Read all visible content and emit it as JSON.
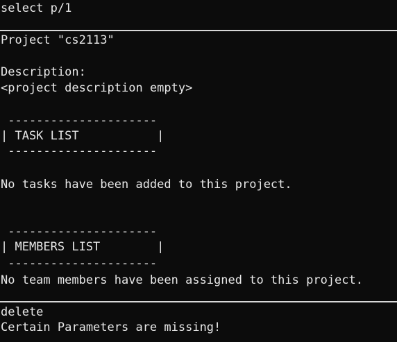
{
  "command_1": "select p/1",
  "output": {
    "project_title": "Project \"cs2113\"",
    "description_label": "Description:",
    "description_value": "<project description empty>",
    "task_box_top": " ---------------------",
    "task_box_label": "| TASK LIST           |",
    "task_box_bottom": " ---------------------",
    "no_tasks_message": "No tasks have been added to this project.",
    "members_box_top": " ---------------------",
    "members_box_label": "| MEMBERS LIST        |",
    "members_box_bottom": " ---------------------",
    "no_members_message": "No team members have been assigned to this project."
  },
  "command_2": "delete",
  "error_message": "Certain Parameters are missing!"
}
